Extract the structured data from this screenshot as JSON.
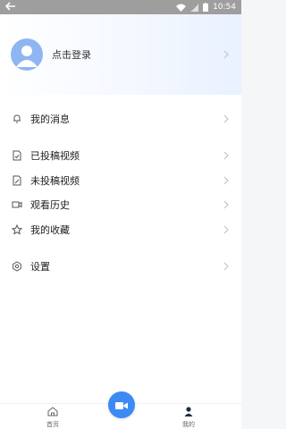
{
  "status_bar": {
    "time": "10:54",
    "icons": [
      "back-arrow-icon",
      "wifi-icon",
      "signal-icon",
      "battery-icon"
    ]
  },
  "profile": {
    "login_label": "点击登录"
  },
  "menu": {
    "messages": "我的消息",
    "submitted_videos": "已投稿视频",
    "unsubmitted_videos": "未投稿视频",
    "watch_history": "观看历史",
    "favorites": "我的收藏",
    "settings": "设置"
  },
  "bottom_nav": {
    "home": "首页",
    "mine": "我的"
  },
  "colors": {
    "accent": "#3b8af5",
    "avatar": "#8fb6f3"
  }
}
